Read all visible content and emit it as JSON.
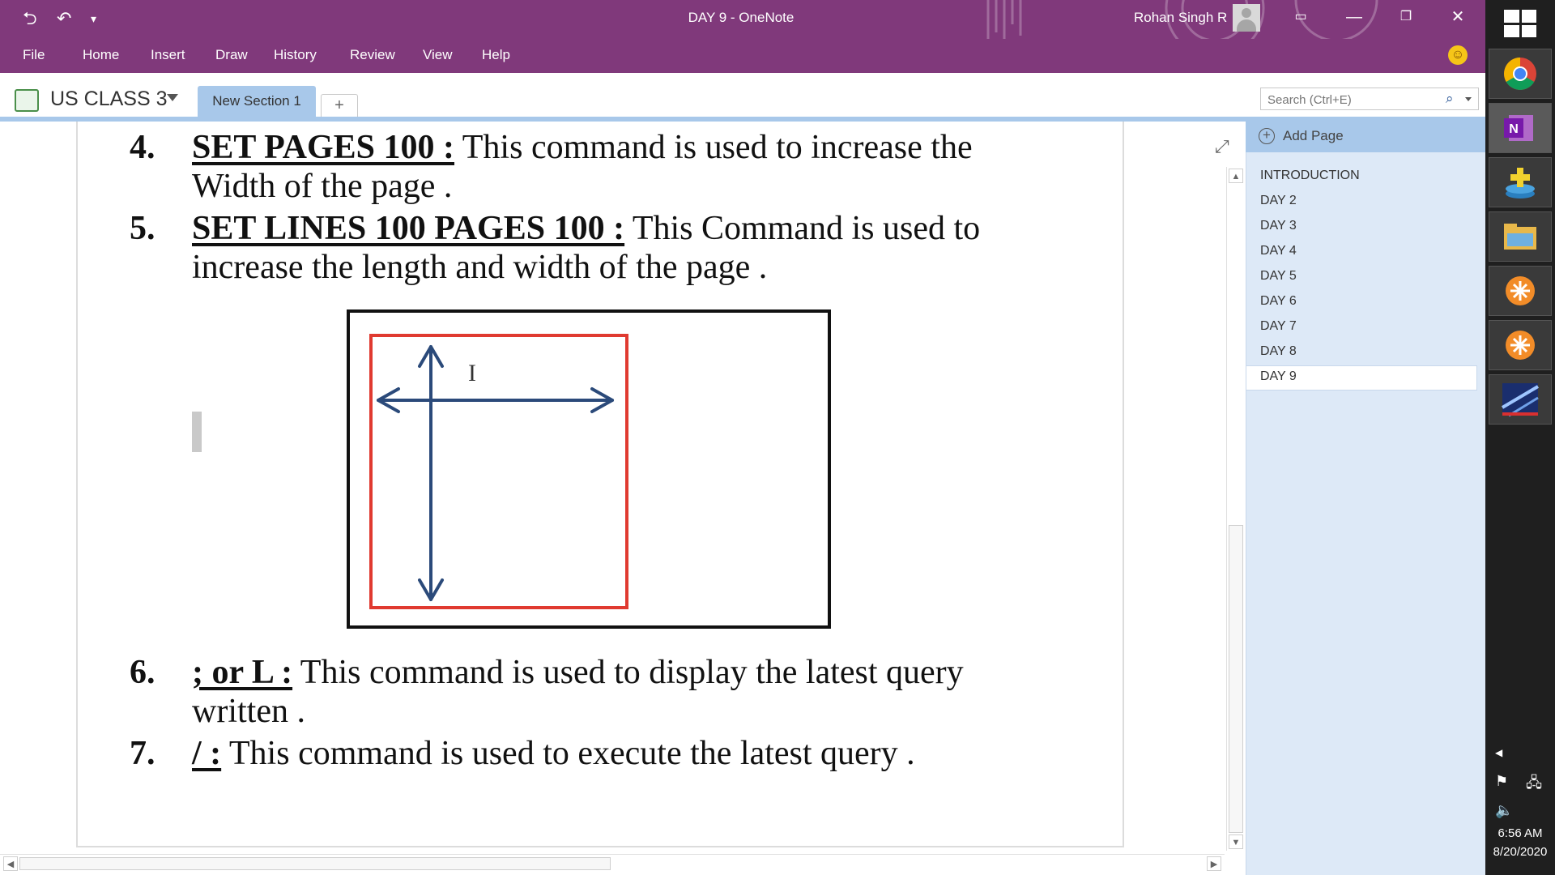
{
  "window": {
    "title": "DAY 9  -  OneNote",
    "user_name": "Rohan Singh R"
  },
  "menu": [
    "File",
    "Home",
    "Insert",
    "Draw",
    "History",
    "Review",
    "View",
    "Help"
  ],
  "notebook": {
    "name": "US CLASS 3",
    "section_tab": "New Section 1",
    "add_tab": "+"
  },
  "search": {
    "placeholder": "Search (Ctrl+E)"
  },
  "page_panel": {
    "add_page_label": "Add Page",
    "pages": [
      "INTRODUCTION",
      "DAY 2",
      "DAY 3",
      "DAY 4",
      "DAY 5",
      "DAY 6",
      "DAY 7",
      "DAY 8",
      "DAY 9"
    ],
    "selected": "DAY 9"
  },
  "content": {
    "items": [
      {
        "num": "4.",
        "cmd": "SET PAGES 100 :",
        "text": " This command is used to increase the Width of the page ."
      },
      {
        "num": "5.",
        "cmd": "SET LINES 100 PAGES 100 :",
        "text": " This Command is used to increase the length and width of the page ."
      },
      {
        "num": "6.",
        "cmd": "; or L :",
        "text": " This command is used to display the latest query written ."
      },
      {
        "num": "7.",
        "cmd": "/ :",
        "text": " This command is used to execute the latest query ."
      }
    ]
  },
  "taskbar": {
    "time": "6:56 AM",
    "date": "8/20/2020",
    "apps": [
      "chrome-icon",
      "onenote-icon",
      "app-plus-icon",
      "file-explorer-icon",
      "app-orange-icon",
      "app-orange-icon",
      "app-photo-icon"
    ]
  },
  "colors": {
    "title_bar": "#80397b",
    "section_tab": "#a8c8ea",
    "page_panel": "#dde9f7",
    "figure_inner_border": "#e03a30",
    "arrow": "#2b4a7a"
  }
}
